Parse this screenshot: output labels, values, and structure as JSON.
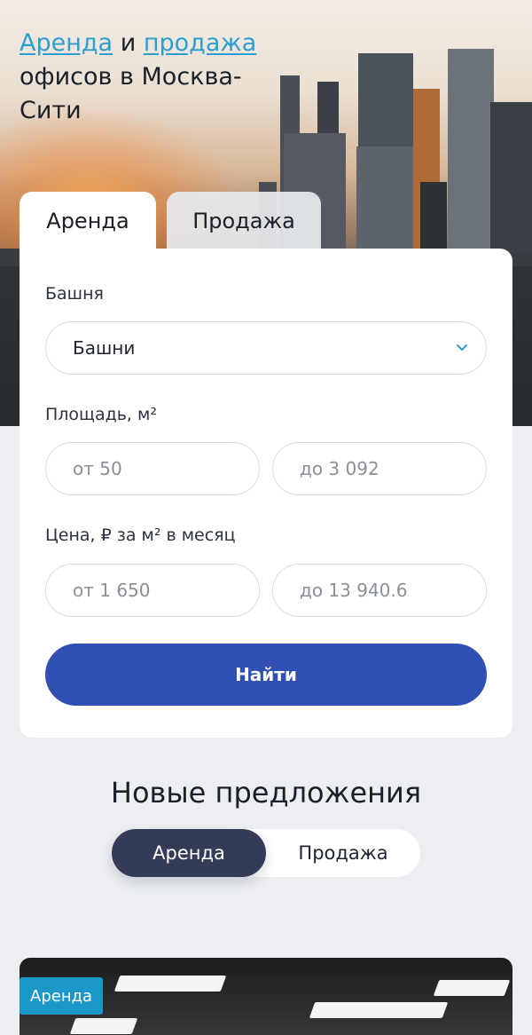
{
  "hero": {
    "title_link1": "Аренда",
    "title_and": "и",
    "title_link2": "продажа",
    "title_rest": "офисов в Москва-Сити"
  },
  "search": {
    "tabs": {
      "rent": "Аренда",
      "sale": "Продажа"
    },
    "tower_label": "Башня",
    "tower_value": "Башни",
    "area_label": "Площадь, м²",
    "area_from": "от 50",
    "area_to": "до 3 092",
    "price_label": "Цена, ₽ за м² в месяц",
    "price_from": "от 1 650",
    "price_to": "до 13 940.6",
    "submit": "Найти"
  },
  "offers": {
    "title": "Новые предложения",
    "toggle_rent": "Аренда",
    "toggle_sale": "Продажа"
  },
  "listing": {
    "badge": "Аренда"
  },
  "colors": {
    "accent_blue": "#3150b4",
    "link_blue": "#2a9fd0",
    "dark_segment": "#333b57",
    "badge": "#1b98c8"
  },
  "icons": {
    "select_chevron": "chevron-down-icon"
  }
}
